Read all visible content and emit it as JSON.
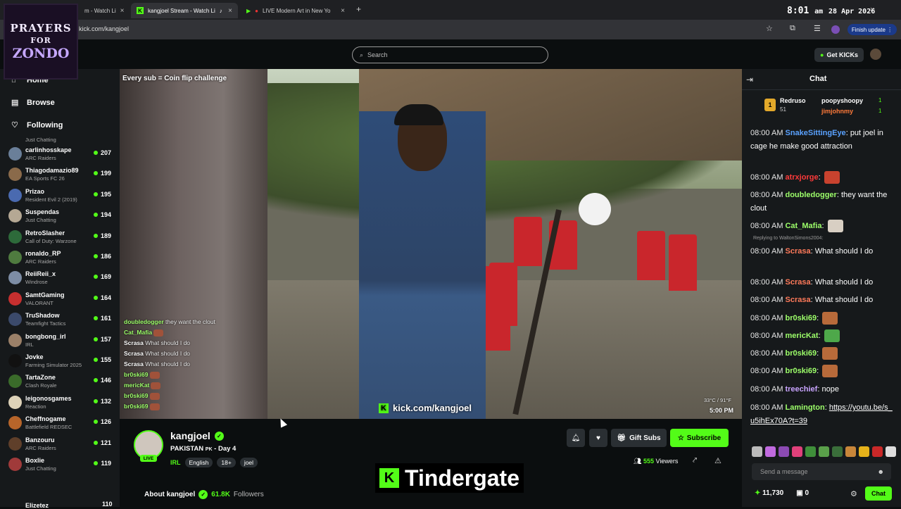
{
  "browser": {
    "tabs": [
      {
        "label": "m - Watch Li"
      },
      {
        "label": "kangjoel Stream - Watch Li"
      },
      {
        "label": "LIVE Modern Art in New Yo"
      }
    ],
    "url": "kick.com/kangjoel",
    "finish_update": "Finish update",
    "new_tab_label": "+"
  },
  "clock": {
    "time": "8:01",
    "ampm": "am",
    "date": "28 Apr 2026"
  },
  "logo": {
    "line1": "PRAYERS",
    "line2": "FOR",
    "line3": "ZONDO"
  },
  "header": {
    "search_placeholder": "Search",
    "get_kicks": "Get KICKs"
  },
  "sidebar": {
    "nav": [
      {
        "label": "Home",
        "icon": "home-icon"
      },
      {
        "label": "Browse",
        "icon": "browse-icon"
      },
      {
        "label": "Following",
        "icon": "heart-icon"
      }
    ],
    "top_partial_game": "Just Chatting",
    "following": [
      {
        "name": "carlinhosskape",
        "game": "ARC Raiders",
        "viewers": "207",
        "color": "#6a7f99"
      },
      {
        "name": "Thiagodamazio89",
        "game": "EA Sports FC 26",
        "viewers": "199",
        "color": "#8a6a4a"
      },
      {
        "name": "Prizao",
        "game": "Resident Evil 2 (2019)",
        "viewers": "195",
        "color": "#4a6ab0"
      },
      {
        "name": "Suspendas",
        "game": "Just Chatting",
        "viewers": "194",
        "color": "#b5a894"
      },
      {
        "name": "RetroSlasher",
        "game": "Call of Duty: Warzone",
        "viewers": "189",
        "color": "#2d6a3a"
      },
      {
        "name": "ronaldo_RP",
        "game": "ARC Raiders",
        "viewers": "186",
        "color": "#4f7b3f"
      },
      {
        "name": "ReiiReii_x",
        "game": "Windrose",
        "viewers": "169",
        "color": "#7d8da5"
      },
      {
        "name": "SamtGaming",
        "game": "VALORANT",
        "viewers": "164",
        "color": "#c62f2f"
      },
      {
        "name": "TruShadow",
        "game": "Teamfight Tactics",
        "viewers": "161",
        "color": "#3b4a6b"
      },
      {
        "name": "bongbong_irl",
        "game": "IRL",
        "viewers": "157",
        "color": "#9b8068"
      },
      {
        "name": "Jovke",
        "game": "Farming Simulator 2025",
        "viewers": "155",
        "color": "#111111"
      },
      {
        "name": "TartaZone",
        "game": "Clash Royale",
        "viewers": "146",
        "color": "#3a6b2a"
      },
      {
        "name": "leigonosgames",
        "game": "Reaction",
        "viewers": "132",
        "color": "#ddd2b8"
      },
      {
        "name": "Cheffnogame",
        "game": "Battlefield REDSEC",
        "viewers": "126",
        "color": "#b7652a"
      },
      {
        "name": "Banzouru",
        "game": "ARC Raiders",
        "viewers": "121",
        "color": "#5f3f2a"
      },
      {
        "name": "Boxlie",
        "game": "Just Chatting",
        "viewers": "119",
        "color": "#a03a3a"
      }
    ],
    "bottom_partial_name": "Elizetez",
    "bottom_partial_viewers": "110"
  },
  "video": {
    "banner": "Every sub = Coin flip challenge",
    "overlay_chat": [
      {
        "user": "doubledogger",
        "text": " they want the clout"
      },
      {
        "user": "Cat_Mafia",
        "text": ""
      },
      {
        "user": "Scrasa",
        "text": " What should I do"
      },
      {
        "user": "Scrasa",
        "text": " What should I do"
      },
      {
        "user": "Scrasa",
        "text": " What should I do"
      },
      {
        "user": "br0ski69",
        "text": ""
      },
      {
        "user": "mericKat",
        "text": ""
      },
      {
        "user": "br0ski69",
        "text": ""
      },
      {
        "user": "br0ski69",
        "text": ""
      }
    ],
    "watermark": "kick.com/kangjoel",
    "weather": "33°C / 91°F",
    "time": "5:00 PM"
  },
  "stream": {
    "name": "kangjoel",
    "title": "PAKISTAN",
    "title_flag": "PK",
    "title_day": "- Day 4",
    "category": "IRL",
    "tags": [
      "English",
      "18+",
      "joel"
    ],
    "live_label": "LIVE",
    "gift_subs": "Gift Subs",
    "subscribe": "Subscribe",
    "viewers_count": "555",
    "viewers_label": "Viewers",
    "about_label": "About kangjoel",
    "followers_count": "61.8K",
    "followers_label": "Followers"
  },
  "caption": {
    "text": "Tindergate"
  },
  "chat": {
    "title": "Chat",
    "leaderboard": [
      {
        "name": "Redruso",
        "value": "51",
        "rank": "1"
      },
      {
        "name": "poopyshoopy",
        "value": "1"
      },
      {
        "name": "jimjohnmy",
        "value": "1"
      }
    ],
    "reply_note": "Replying to WaltonSimons2004:",
    "messages": [
      {
        "time": "08:00 AM",
        "user": "SnakeSittingEye",
        "color": "#5aa2ff",
        "text": "put joel in cage he make good attraction"
      },
      {
        "time": "08:00 AM",
        "user": "atrxjorge",
        "color": "#ff3a3a",
        "text": ""
      },
      {
        "time": "08:00 AM",
        "user": "doubledogger",
        "color": "#9dff6a",
        "text": "they want the clout"
      },
      {
        "time": "08:00 AM",
        "user": "Cat_Mafia",
        "color": "#9dff6a",
        "text": ""
      },
      {
        "time": "08:00 AM",
        "user": "Scrasa",
        "color": "#ff7a5a",
        "text": "What should I do"
      },
      {
        "time": "08:00 AM",
        "user": "Scrasa",
        "color": "#ff7a5a",
        "text": "What should I do"
      },
      {
        "time": "08:00 AM",
        "user": "Scrasa",
        "color": "#ff7a5a",
        "text": "What should I do"
      },
      {
        "time": "08:00 AM",
        "user": "br0ski69",
        "color": "#9dff6a",
        "text": ""
      },
      {
        "time": "08:00 AM",
        "user": "mericKat",
        "color": "#9dff6a",
        "text": ""
      },
      {
        "time": "08:00 AM",
        "user": "br0ski69",
        "color": "#9dff6a",
        "text": ""
      },
      {
        "time": "08:00 AM",
        "user": "br0ski69",
        "color": "#9dff6a",
        "text": ""
      },
      {
        "time": "08:00 AM",
        "user": "treechief",
        "color": "#c9a4ff",
        "text": "nope"
      },
      {
        "time": "08:00 AM",
        "user": "Lamington",
        "color": "#9dff6a",
        "text": "https://youtu.be/s_u5ihEx70A?t=39"
      }
    ],
    "input_placeholder": "Send a message",
    "points": "11,730",
    "subs_points": "0",
    "chat_button": "Chat"
  },
  "colors": {
    "accent": "#53fc18",
    "background": "#0b0e0f",
    "panel": "#16191b"
  }
}
